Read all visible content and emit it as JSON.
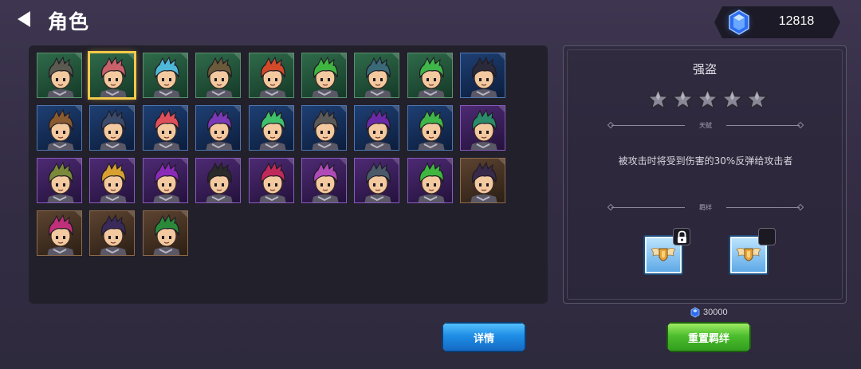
{
  "header": {
    "title": "角色",
    "back_icon": "back-arrow-icon",
    "currency": {
      "icon": "blue-gem-icon",
      "amount": "12818"
    }
  },
  "roster": {
    "characters": [
      {
        "frame": "green",
        "hair": "#5a5a50",
        "selected": false
      },
      {
        "frame": "green",
        "hair": "#c8616a",
        "selected": true
      },
      {
        "frame": "green",
        "hair": "#4fb8d8",
        "selected": false
      },
      {
        "frame": "green",
        "hair": "#6b5a3a",
        "selected": false
      },
      {
        "frame": "green",
        "hair": "#d24a2a",
        "selected": false
      },
      {
        "frame": "green",
        "hair": "#3fb640",
        "selected": false
      },
      {
        "frame": "green",
        "hair": "#3a6a78",
        "selected": false
      },
      {
        "frame": "green",
        "hair": "#3fb648",
        "selected": false
      },
      {
        "frame": "blue",
        "hair": "#2a2a3a",
        "selected": false
      },
      {
        "frame": "blue",
        "hair": "#8a5a30",
        "selected": false
      },
      {
        "frame": "blue",
        "hair": "#3a4a6a",
        "selected": false
      },
      {
        "frame": "blue",
        "hair": "#e0505a",
        "selected": false
      },
      {
        "frame": "blue",
        "hair": "#7a3ab8",
        "selected": false
      },
      {
        "frame": "blue",
        "hair": "#3fc06a",
        "selected": false
      },
      {
        "frame": "blue",
        "hair": "#5a5a58",
        "selected": false
      },
      {
        "frame": "blue",
        "hair": "#6a2aa8",
        "selected": false
      },
      {
        "frame": "blue",
        "hair": "#3fb64a",
        "selected": false
      },
      {
        "frame": "purple",
        "hair": "#2a8a6a",
        "selected": false
      },
      {
        "frame": "purple",
        "hair": "#7a8a3a",
        "selected": false
      },
      {
        "frame": "purple",
        "hair": "#d8a030",
        "selected": false
      },
      {
        "frame": "purple",
        "hair": "#8a2ab8",
        "selected": false
      },
      {
        "frame": "purple",
        "hair": "#2a2a2a",
        "selected": false
      },
      {
        "frame": "purple",
        "hair": "#c02a5a",
        "selected": false
      },
      {
        "frame": "purple",
        "hair": "#b04ab8",
        "selected": false
      },
      {
        "frame": "purple",
        "hair": "#4a5a6a",
        "selected": false
      },
      {
        "frame": "purple",
        "hair": "#3fb640",
        "selected": false
      },
      {
        "frame": "brown",
        "hair": "#3a2a4a",
        "selected": false
      },
      {
        "frame": "brown",
        "hair": "#c0307a",
        "selected": false
      },
      {
        "frame": "brown",
        "hair": "#3a2a5a",
        "selected": false
      },
      {
        "frame": "brown",
        "hair": "#2a8a3a",
        "selected": false
      }
    ]
  },
  "details": {
    "name": "强盗",
    "stars": {
      "filled": 0,
      "total": 5
    },
    "talent_label": "天赋",
    "talent_text": "被攻击时将受到伤害的30%反弹给攻击者",
    "bond_label": "羁绊",
    "bonds": [
      {
        "icon": "winged-shield-icon",
        "locked": true
      },
      {
        "icon": "winged-shield-icon",
        "locked": false
      }
    ]
  },
  "actions": {
    "details_button": "详情",
    "reset_cost": "30000",
    "reset_button": "重置羁绊"
  },
  "colors": {
    "background": "#342d45",
    "selected_outline": "#f4c94a",
    "details_button": "#1f8ee6",
    "reset_button": "#4dbe2e"
  }
}
